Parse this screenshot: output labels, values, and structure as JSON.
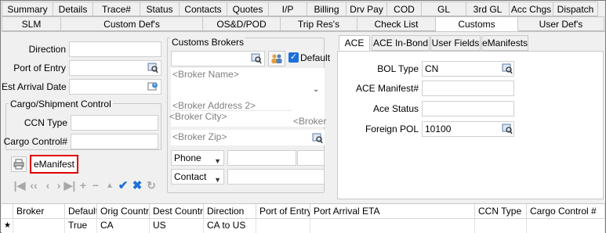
{
  "tabs_row1": [
    {
      "label": "Summary"
    },
    {
      "label": "Details"
    },
    {
      "label": "Trace#"
    },
    {
      "label": "Status"
    },
    {
      "label": "Contacts"
    },
    {
      "label": "Quotes"
    },
    {
      "label": "I/P"
    },
    {
      "label": "Billing"
    },
    {
      "label": "Drv Pay"
    },
    {
      "label": "COD"
    },
    {
      "label": "GL"
    },
    {
      "label": "3rd GL"
    },
    {
      "label": "Acc Chgs"
    },
    {
      "label": "Dispatch"
    }
  ],
  "tabs_row2": [
    {
      "label": "SLM"
    },
    {
      "label": "Custom Def's"
    },
    {
      "label": "OS&D/POD"
    },
    {
      "label": "Trip Res's"
    },
    {
      "label": "Check List"
    },
    {
      "label": "Customs"
    },
    {
      "label": "User Def's"
    }
  ],
  "left": {
    "direction_label": "Direction",
    "direction_value": "",
    "port_label": "Port of Entry",
    "port_value": "",
    "arrival_label": "Est Arrival Date",
    "arrival_value": "",
    "cargo_group_label": "Cargo/Shipment Control",
    "ccn_label": "CCN Type",
    "ccn_value": "",
    "cargo_control_label": "Cargo Control#",
    "cargo_control_value": "",
    "emanifest_button": "eManifest"
  },
  "brokers": {
    "title": "Customs Brokers",
    "default_label": "Default",
    "default_checked": true,
    "broker_name_placeholder": "<Broker Name>",
    "broker_address_placeholder": "<Broker Address 2>",
    "broker_city_placeholder": "<Broker City>",
    "broker_right_placeholder": "<Broker",
    "broker_zip_placeholder": "<Broker Zip>",
    "phone_label": "Phone",
    "contact_label": "Contact"
  },
  "ace": {
    "tabs": [
      {
        "label": "ACE"
      },
      {
        "label": "ACE In-Bond"
      },
      {
        "label": "User Fields"
      },
      {
        "label": "eManifests"
      }
    ],
    "bol_type_label": "BOL Type",
    "bol_type_value": "CN",
    "ace_manifest_label": "ACE Manifest#",
    "ace_manifest_value": "",
    "ace_status_label": "Ace Status",
    "ace_status_value": "",
    "foreign_pol_label": "Foreign POL",
    "foreign_pol_value": "10100"
  },
  "grid": {
    "columns": [
      "Broker",
      "Default",
      "Orig Country",
      "Dest Country",
      "Direction",
      "Port of Entry",
      "Port Arrival ETA",
      "CCN Type",
      "Cargo Control #"
    ],
    "row_marker": "★",
    "rows": [
      {
        "broker": "",
        "default": "True",
        "orig_country": "CA",
        "dest_country": "US",
        "direction": "CA to US",
        "port_of_entry": "",
        "port_arrival_eta": "",
        "ccn_type": "",
        "cargo_control": ""
      }
    ]
  },
  "colors": {
    "highlight_border": "#e00000",
    "check_blue": "#1e6fd9"
  }
}
